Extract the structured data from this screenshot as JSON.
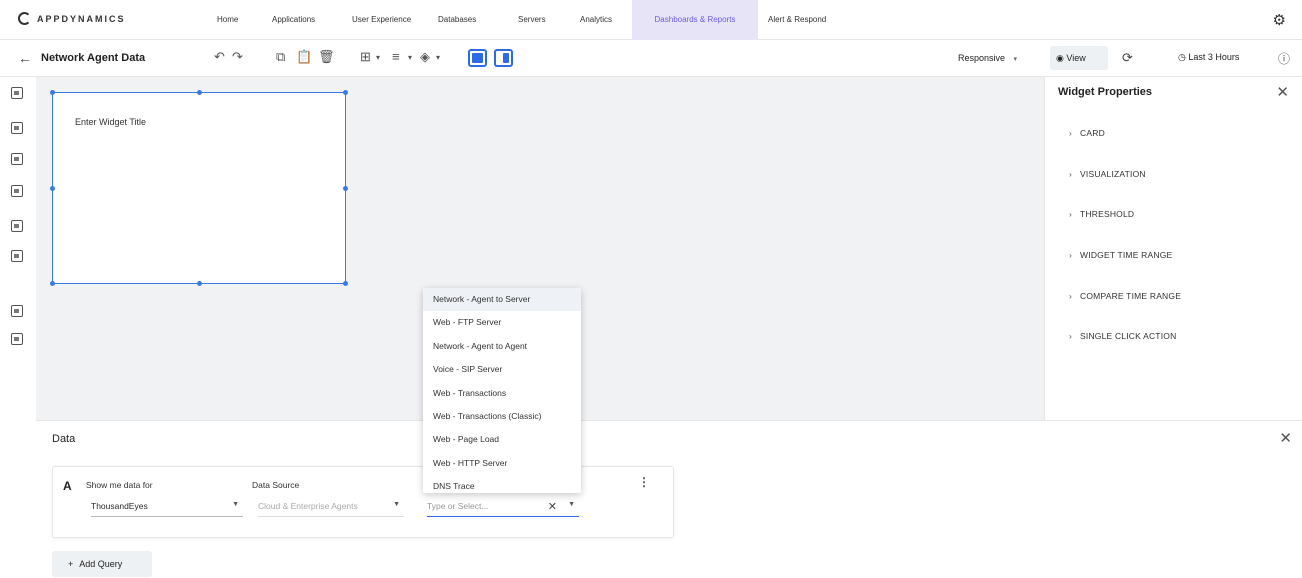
{
  "brand": {
    "name": "APPDYNAMICS"
  },
  "nav": {
    "items": [
      {
        "label": "Home"
      },
      {
        "label": "Applications"
      },
      {
        "label": "User Experience"
      },
      {
        "label": "Databases"
      },
      {
        "label": "Servers"
      },
      {
        "label": "Analytics"
      },
      {
        "label": "Dashboards & Reports"
      },
      {
        "label": "Alert & Respond"
      }
    ],
    "active_index": 6,
    "accent_color": "#6b5ce7"
  },
  "toolbar": {
    "title": "Network Agent Data",
    "responsive_label": "Responsive",
    "view_label": "View",
    "time_range_label": "Last 3 Hours",
    "accent_color": "#2d6be4"
  },
  "widget": {
    "title": "Enter Widget Title"
  },
  "properties": {
    "title": "Widget Properties",
    "sections": [
      {
        "label": "CARD"
      },
      {
        "label": "VISUALIZATION"
      },
      {
        "label": "THRESHOLD"
      },
      {
        "label": "WIDGET TIME RANGE"
      },
      {
        "label": "COMPARE TIME RANGE"
      },
      {
        "label": "SINGLE CLICK ACTION"
      }
    ]
  },
  "data_panel": {
    "title": "Data",
    "query": {
      "letter": "A",
      "show_me_label": "Show me data for",
      "show_me_value": "ThousandEyes",
      "source_label": "Data Source",
      "source_value": "Cloud & Enterprise Agents",
      "test_placeholder": "Type or Select..."
    },
    "add_query_label": "Add Query"
  },
  "dropdown": {
    "items": [
      {
        "label": "Network - Agent to Server"
      },
      {
        "label": "Web - FTP Server"
      },
      {
        "label": "Network - Agent to Agent"
      },
      {
        "label": "Voice - SIP Server"
      },
      {
        "label": "Web - Transactions"
      },
      {
        "label": "Web - Transactions (Classic)"
      },
      {
        "label": "Web - Page Load"
      },
      {
        "label": "Web - HTTP Server"
      },
      {
        "label": "DNS Trace"
      }
    ],
    "highlighted_index": 0
  }
}
